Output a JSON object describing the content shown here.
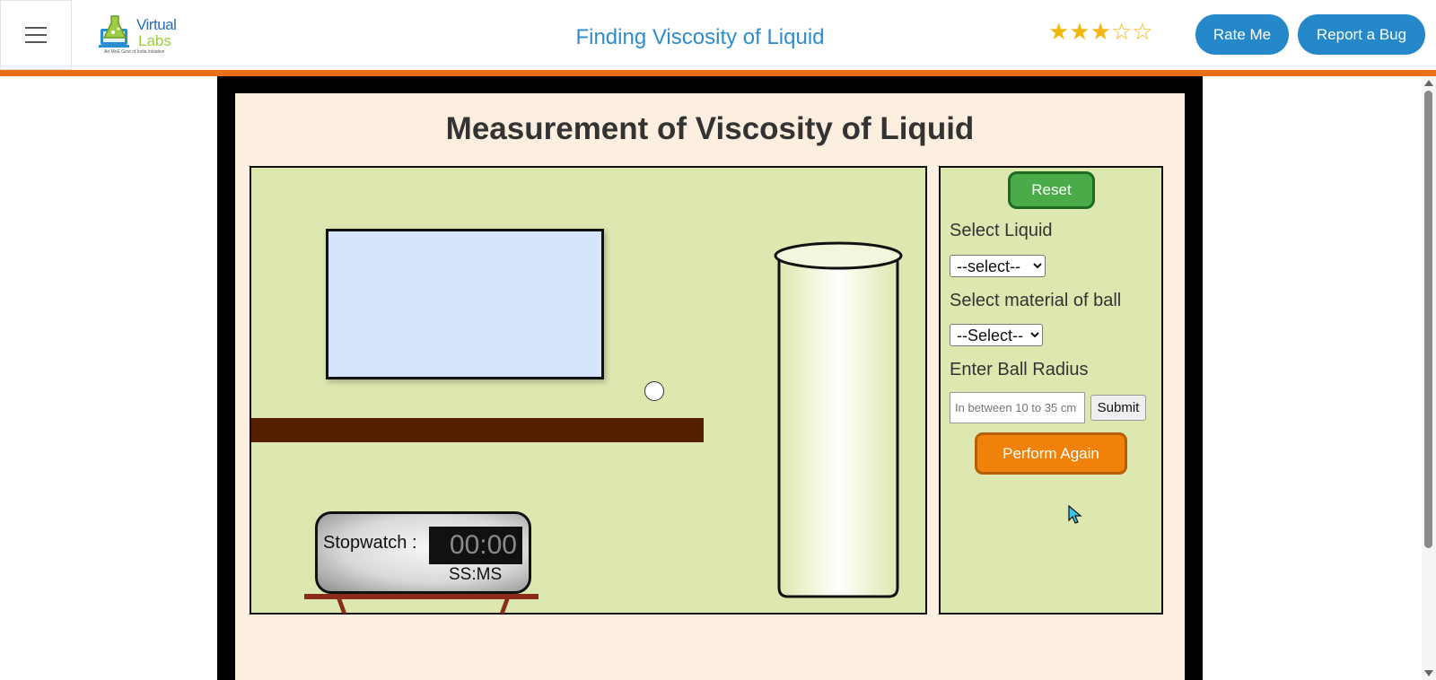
{
  "header": {
    "menu_icon": "hamburger-menu-icon",
    "logo": {
      "line1": "Virtual",
      "line2": "Labs",
      "tagline": "An MoE Govt of India Initiative"
    },
    "title": "Finding Viscosity of Liquid",
    "rating": {
      "filled": 3,
      "total": 5,
      "filled_glyph": "★★★",
      "empty_glyph": "☆☆"
    },
    "rate_label": "Rate Me",
    "bug_label": "Report a Bug"
  },
  "simulation": {
    "title": "Measurement of Viscosity of Liquid",
    "stopwatch": {
      "label": "Stopwatch :",
      "time": "00:00",
      "unit": "SS:MS"
    }
  },
  "controls": {
    "reset_label": "Reset",
    "liquid_label": "Select Liquid",
    "liquid_selected": "--select--",
    "ball_label": "Select material of ball",
    "ball_selected": "--Select--",
    "radius_label": "Enter Ball Radius",
    "radius_placeholder": "In between 10 to 35 cm",
    "submit_label": "Submit",
    "perform_label": "Perform Again"
  },
  "colors": {
    "accent_orange": "#ea6f16",
    "header_blue": "#2488c9",
    "reset_green": "#4aac49",
    "perform_orange": "#f0810a",
    "lab_bg": "#dde8b0",
    "panel_bg": "#fdefe0"
  }
}
